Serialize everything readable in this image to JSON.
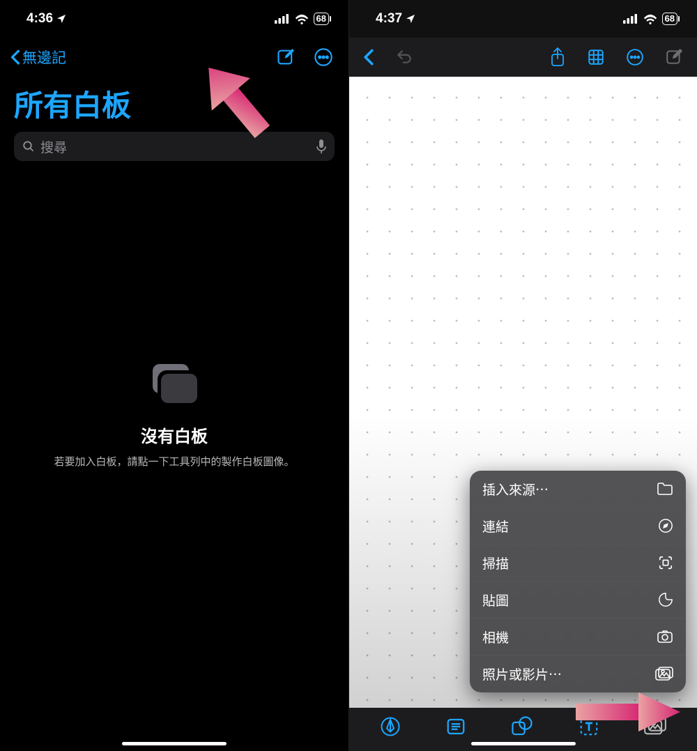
{
  "left": {
    "status": {
      "time": "4:36",
      "battery": "68"
    },
    "nav": {
      "back_label": "無邊記"
    },
    "title": "所有白板",
    "search": {
      "placeholder": "搜尋"
    },
    "empty": {
      "title": "沒有白板",
      "subtitle": "若要加入白板，請點一下工具列中的製作白板圖像。"
    }
  },
  "right": {
    "status": {
      "time": "4:37",
      "battery": "68"
    },
    "menu": {
      "items": [
        {
          "label": "插入來源⋯",
          "icon": "folder-icon"
        },
        {
          "label": "連結",
          "icon": "compass-icon"
        },
        {
          "label": "掃描",
          "icon": "scan-icon"
        },
        {
          "label": "貼圖",
          "icon": "sticker-icon"
        },
        {
          "label": "相機",
          "icon": "camera-icon"
        },
        {
          "label": "照片或影片⋯",
          "icon": "gallery-icon"
        }
      ]
    }
  },
  "colors": {
    "accent": "#1da6ff"
  }
}
